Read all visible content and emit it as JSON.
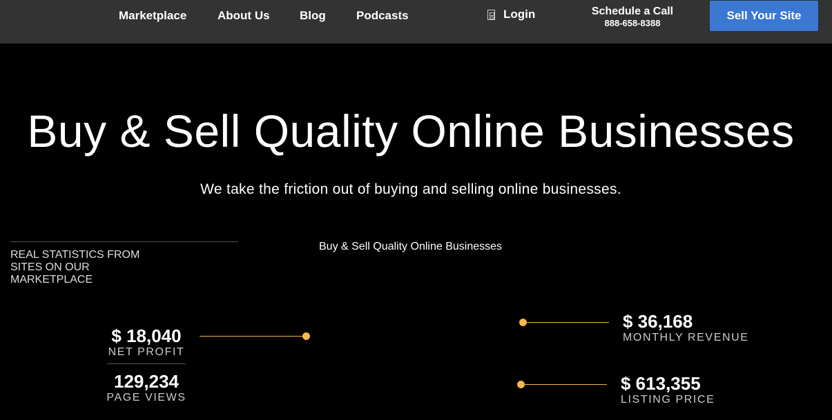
{
  "nav": {
    "links": [
      "Marketplace",
      "About Us",
      "Blog",
      "Podcasts"
    ],
    "login_label": "Login",
    "schedule_title": "Schedule a Call",
    "schedule_phone": "888-658-8388",
    "sell_button": "Sell Your Site",
    "button_color": "#3a78d4"
  },
  "hero": {
    "title": "Buy & Sell Quality Online Businesses",
    "subtitle": "We take the friction out of buying and selling online businesses."
  },
  "stats": {
    "caption": "REAL STATISTICS FROM SITES ON OUR MARKETPLACE",
    "media_caption": "Buy & Sell Quality Online Businesses",
    "accent_color": "#f4b84e",
    "items": [
      {
        "value": "$ 18,040",
        "label": "NET PROFIT"
      },
      {
        "value": "129,234",
        "label": "PAGE VIEWS"
      },
      {
        "value": "$ 36,168",
        "label": "MONTHLY REVENUE"
      },
      {
        "value": "$ 613,355",
        "label": "LISTING PRICE"
      }
    ]
  }
}
